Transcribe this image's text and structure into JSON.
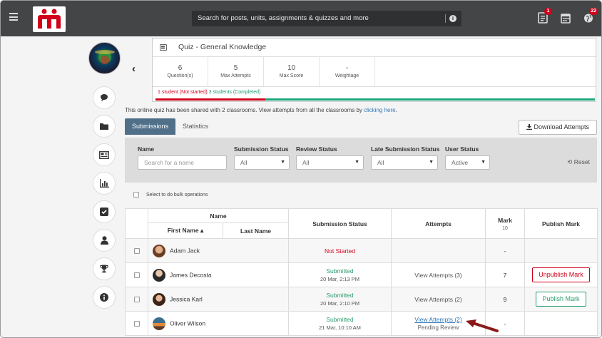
{
  "topbar": {
    "search_placeholder": "Search for posts, units, assignments & quizzes and more",
    "notifications": [
      {
        "icon": "assignment-icon",
        "count": "1"
      },
      {
        "icon": "calendar-icon",
        "count": ""
      },
      {
        "icon": "globe-icon",
        "count": "22"
      }
    ],
    "colors": {
      "bar": "#444546",
      "badge": "#d0021b"
    }
  },
  "sidebar": {
    "items": [
      {
        "icon": "chat-icon"
      },
      {
        "icon": "folder-icon"
      },
      {
        "icon": "newspaper-icon"
      },
      {
        "icon": "bar-chart-icon"
      },
      {
        "icon": "checkbox-icon"
      },
      {
        "icon": "user-icon"
      },
      {
        "icon": "trophy-icon"
      },
      {
        "icon": "info-icon"
      }
    ]
  },
  "quiz": {
    "title": "Quiz - General Knowledge",
    "stats": [
      {
        "value": "6",
        "label": "Question(s)"
      },
      {
        "value": "5",
        "label": "Max Attempts"
      },
      {
        "value": "10",
        "label": "Max Score"
      },
      {
        "value": "-",
        "label": "Weightage"
      }
    ],
    "not_started": "1 student (Not started)",
    "completed": "3 students (Completed)",
    "completion_fraction": 0.75
  },
  "shared_text": "This online quiz has been shared with 2 classrooms. View attempts from all the classrooms by ",
  "shared_link": "clicking here",
  "tabs": [
    {
      "label": "Submissions",
      "active": true
    },
    {
      "label": "Statistics",
      "active": false
    }
  ],
  "download_label": "Download Attempts",
  "filters": {
    "name_label": "Name",
    "name_placeholder": "Search for a name",
    "submission_label": "Submission Status",
    "submission_value": "All",
    "review_label": "Review Status",
    "review_value": "All",
    "late_label": "Late Submission Status",
    "late_value": "All",
    "user_label": "User Status",
    "user_value": "Active",
    "reset_label": "Reset"
  },
  "bulk_label": "Select to do bulk operations",
  "table": {
    "name_header": "Name",
    "first_name_header": "First Name ▴",
    "last_name_header": "Last Name",
    "submission_header": "Submission Status",
    "attempts_header": "Attempts",
    "mark_header": "Mark",
    "mark_max": "10",
    "publish_header": "Publish Mark",
    "rows": [
      {
        "name": "Adam Jack",
        "status": "Not Started",
        "date": "",
        "attempts": "",
        "review": "",
        "mark": "-",
        "publish": ""
      },
      {
        "name": "James Decosta",
        "status": "Submitted",
        "date": "20 Mar, 2:13 PM",
        "attempts": "View Attempts (3)",
        "review": "",
        "mark": "7",
        "publish": "Unpublish Mark"
      },
      {
        "name": "Jessica Karl",
        "status": "Submitted",
        "date": "20 Mar, 2:10 PM",
        "attempts": "View Attempts (2)",
        "review": "",
        "mark": "9",
        "publish": "Publish Mark"
      },
      {
        "name": "Oliver Wilson",
        "status": "Submitted",
        "date": "21 Mar, 10:10 AM",
        "attempts": "View Attempts (2)",
        "review": "Pending Review",
        "mark": "-",
        "publish": ""
      }
    ]
  }
}
